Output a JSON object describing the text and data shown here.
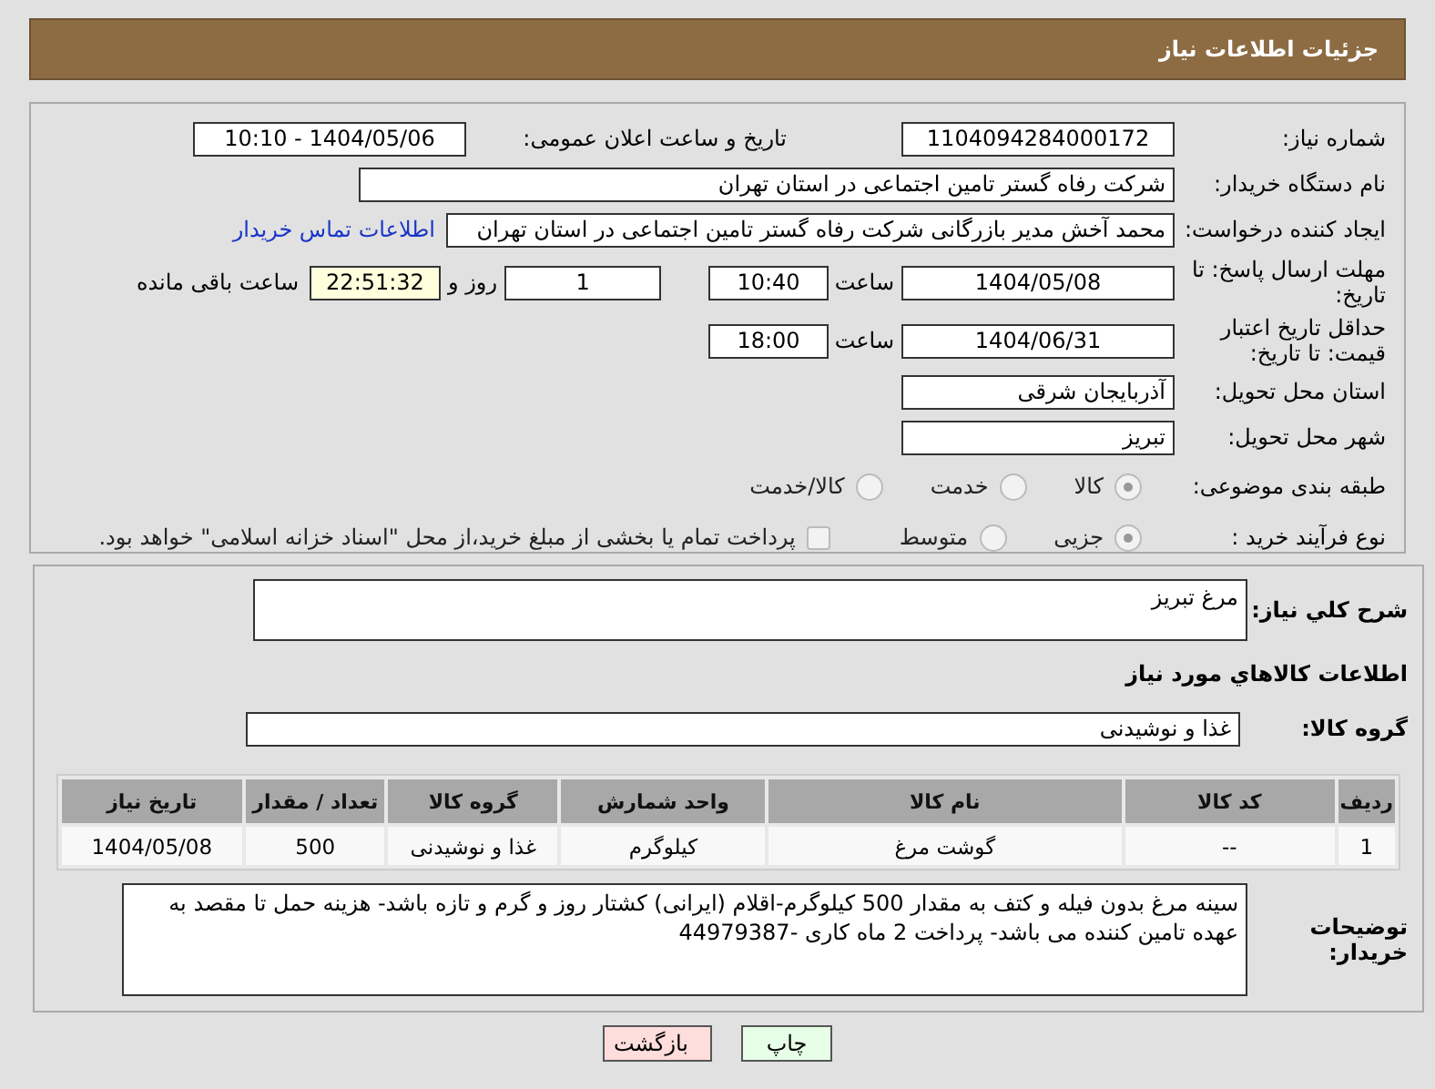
{
  "header": {
    "title": "جزئیات اطلاعات نیاز"
  },
  "need_number": {
    "label": "شماره نیاز:",
    "value": "1104094284000172"
  },
  "announce": {
    "label": "تاریخ و ساعت اعلان عمومی:",
    "value": "1404/05/06 - 10:10"
  },
  "buyer_org": {
    "label": "نام دستگاه خریدار:",
    "value": "شرکت رفاه گستر تامین اجتماعی در استان تهران"
  },
  "requester": {
    "label": "ایجاد کننده درخواست:",
    "value": "محمد آخش مدیر بازرگانی شرکت رفاه گستر تامین اجتماعی در استان تهران",
    "link": "اطلاعات تماس خریدار"
  },
  "reply_deadline": {
    "label": "مهلت ارسال پاسخ: تا تاریخ:",
    "date": "1404/05/08",
    "time_label": "ساعت",
    "time": "10:40",
    "days": "1",
    "days_label": "روز و",
    "remaining": "22:51:32",
    "remaining_label": "ساعت باقی مانده"
  },
  "price_validity": {
    "label": "حداقل تاریخ اعتبار قیمت: تا تاریخ:",
    "date": "1404/06/31",
    "time_label": "ساعت",
    "time": "18:00"
  },
  "province": {
    "label": "استان محل تحویل:",
    "value": "آذربایجان شرقی"
  },
  "city": {
    "label": "شهر محل تحویل:",
    "value": "تبریز"
  },
  "category": {
    "label": "طبقه بندی موضوعی:",
    "options": [
      {
        "label": "کالا",
        "selected": true
      },
      {
        "label": "خدمت",
        "selected": false
      },
      {
        "label": "کالا/خدمت",
        "selected": false
      }
    ]
  },
  "process": {
    "label": "نوع فرآیند خرید :",
    "options": [
      {
        "label": "جزیی",
        "selected": true
      },
      {
        "label": "متوسط",
        "selected": false
      }
    ],
    "treasury": {
      "label": "پرداخت تمام یا بخشی از مبلغ خرید،از محل \"اسناد خزانه اسلامی\" خواهد بود.",
      "checked": false
    }
  },
  "description": {
    "label": "شرح كلي نياز:",
    "value": "مرغ تبریز"
  },
  "goods_title": "اطلاعات كالاهاي مورد نياز",
  "goods_group": {
    "label": "گروه کالا:",
    "value": "غذا و نوشیدنی"
  },
  "table": {
    "columns": [
      "ردیف",
      "کد کالا",
      "نام کالا",
      "واحد شمارش",
      "گروه کالا",
      "تعداد / مقدار",
      "تاریخ نیاز"
    ],
    "rows": [
      [
        "1",
        "--",
        "گوشت مرغ",
        "کیلوگرم",
        "غذا و نوشیدنی",
        "500",
        "1404/05/08"
      ]
    ]
  },
  "buyer_notes": {
    "label": "توضیحات خریدار:",
    "value": "سینه مرغ بدون فیله و کتف به مقدار 500 کیلوگرم-اقلام (ایرانی) کشتار روز و گرم و تازه باشد- هزینه حمل تا مقصد به عهده تامین کننده می باشد- پرداخت 2 ماه کاری -44979387"
  },
  "buttons": [
    {
      "label": "چاپ",
      "kind": "print"
    },
    {
      "label": "بازگشت",
      "kind": "back"
    }
  ]
}
